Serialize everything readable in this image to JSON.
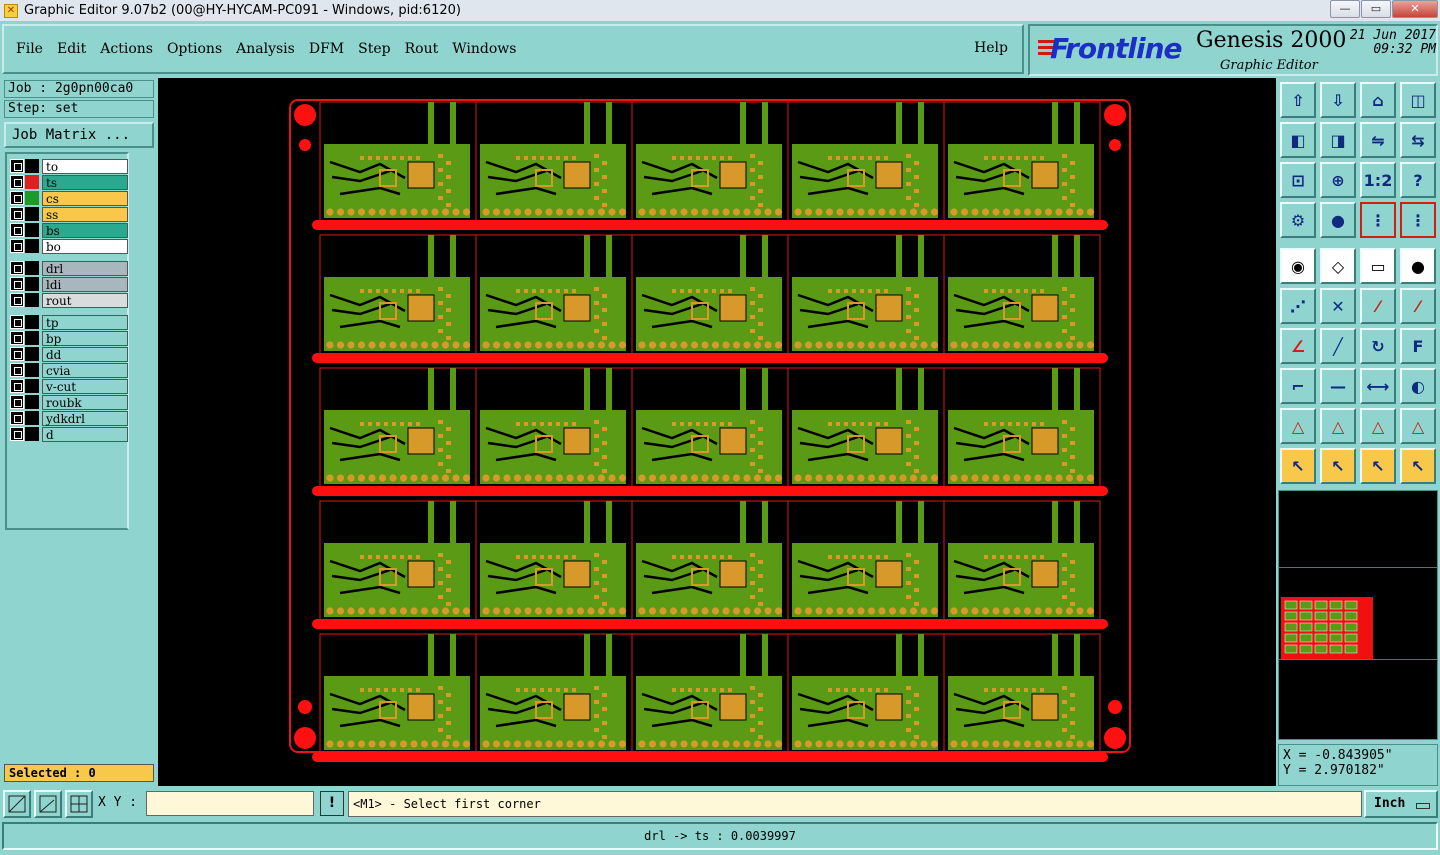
{
  "window": {
    "title": "Graphic Editor 9.07b2 (00@HY-HYCAM-PC091 - Windows, pid:6120)",
    "controls": [
      "—",
      "▭",
      "✕"
    ]
  },
  "menubar": {
    "items": [
      "File",
      "Edit",
      "Actions",
      "Options",
      "Analysis",
      "DFM",
      "Step",
      "Rout",
      "Windows"
    ],
    "help": "Help"
  },
  "brand": {
    "logo": "Frontline",
    "product": "Genesis 2000",
    "subtitle": "Graphic Editor",
    "date": "21 Jun 2017",
    "time": "09:32 PM"
  },
  "job": {
    "job_line": "Job : 2g0pn00ca0",
    "step_line": "Step: set",
    "matrix_button": "Job Matrix ...",
    "selected": "Selected : 0"
  },
  "layers": {
    "board": [
      {
        "name": "to",
        "color": "#000000",
        "bg": "#ffffff"
      },
      {
        "name": "ts",
        "color": "#e02020",
        "bg": "#2aa98f",
        "active": true
      },
      {
        "name": "cs",
        "color": "#1c9a2a",
        "bg": "#f7c84a"
      },
      {
        "name": "ss",
        "color": "#000000",
        "bg": "#f7c84a"
      },
      {
        "name": "bs",
        "color": "#000000",
        "bg": "#2aa98f"
      },
      {
        "name": "bo",
        "color": "#000000",
        "bg": "#ffffff"
      }
    ],
    "drill": [
      {
        "name": "drl",
        "bg": "#a9b6bd"
      },
      {
        "name": "ldi",
        "bg": "#a9b6bd"
      },
      {
        "name": "rout",
        "bg": "#d8dcdc"
      }
    ],
    "misc": [
      {
        "name": "tp",
        "bg": "#8fd4cf"
      },
      {
        "name": "bp",
        "bg": "#8fd4cf"
      },
      {
        "name": "dd",
        "bg": "#8fd4cf"
      },
      {
        "name": "cvia",
        "bg": "#8fd4cf"
      },
      {
        "name": "v-cut",
        "bg": "#8fd4cf"
      },
      {
        "name": "roubk",
        "bg": "#8fd4cf"
      },
      {
        "name": "ydkdrl",
        "bg": "#8fd4cf"
      },
      {
        "name": "d",
        "bg": "#8fd4cf"
      }
    ]
  },
  "panel": {
    "rows": 5,
    "cols": 5,
    "board_color": "#5a9a14",
    "copper_color": "#d79a2a",
    "rail_color": "#ff1010",
    "outline_color": "#e01818"
  },
  "toolbox": {
    "tools": [
      "export-icon",
      "import-icon",
      "home-icon",
      "window-split-icon",
      "move-left-icon",
      "move-right-icon",
      "mirror-icon",
      "swap-icon",
      "fit-icon",
      "zoom-fit-icon",
      "ratio-icon",
      "help-icon",
      "tools-icon",
      "probe-icon",
      "traffic-light-icon",
      "traffic-light-red-icon",
      "snap-icon",
      "polygon-icon",
      "ruler-icon",
      "pad-icon",
      "net-icon",
      "cross-icon",
      "line-point-icon",
      "line-end-icon",
      "angle-icon",
      "diagonal-icon",
      "rotate-icon",
      "ff-icon",
      "corner-icon",
      "dash-icon",
      "measure-icon",
      "shapes-icon",
      "triangle-a-icon",
      "triangle-b-icon",
      "triangle-c-icon",
      "triangle-d-icon",
      "pointer-icon",
      "select-box-icon",
      "select-circle-icon",
      "select-path-icon"
    ],
    "ratio_label": "1:2",
    "help_label": "?"
  },
  "coords": {
    "x": "X = -0.843905\"",
    "y": "Y = 2.970182\""
  },
  "bottom": {
    "xy_label": "X Y :",
    "xy_value": "",
    "excl": "!",
    "prompt": "<M1> - Select first corner",
    "unit": "Inch",
    "status": "drl -> ts : 0.0039997"
  }
}
